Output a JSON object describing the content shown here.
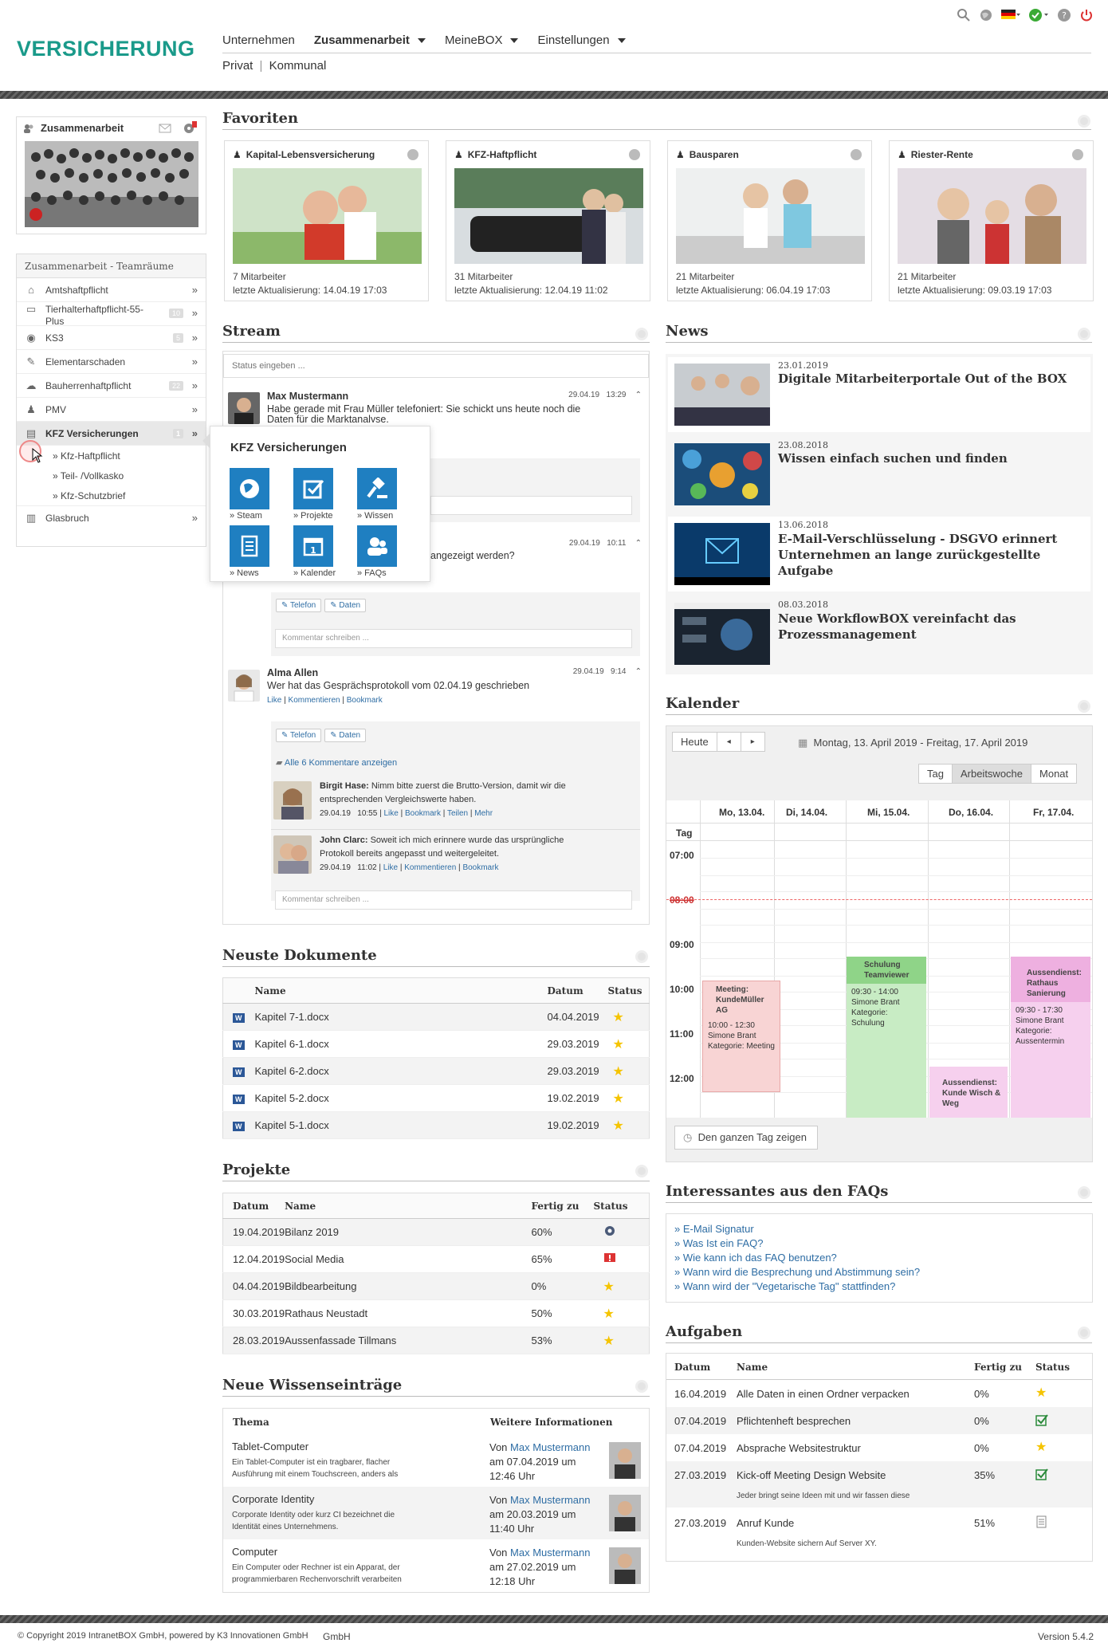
{
  "header": {
    "logo": "VERSICHERUNG",
    "nav": [
      {
        "label": "Unternehmen"
      },
      {
        "label": "Zusammenarbeit"
      },
      {
        "label": "MeineBOX"
      },
      {
        "label": "Einstellungen"
      }
    ],
    "subnav": [
      "Privat",
      "Kommunal"
    ]
  },
  "sidebar": {
    "group_title": "Zusammenarbeit",
    "teamraeume_title": "Zusammenarbeit - Teamräume",
    "items": [
      {
        "label": "Amtshaftpflicht",
        "count": ""
      },
      {
        "label": "Tierhalterhaftpflicht-55-",
        "label2": "Plus",
        "count": "10"
      },
      {
        "label": "KS3",
        "count": "5"
      },
      {
        "label": "Elementarschaden",
        "count": ""
      },
      {
        "label": "Bauherrenhaftpflicht",
        "count": "22"
      },
      {
        "label": "PMV",
        "count": ""
      },
      {
        "label": "KFZ Versicherungen",
        "count": "1"
      }
    ],
    "subitems": [
      "» Kfz-Haftpflicht",
      "» Teil- /Vollkasko",
      "» Kfz-Schutzbrief"
    ],
    "last": {
      "label": "Glasbruch"
    },
    "arrow": "»"
  },
  "popup": {
    "title": "KFZ Versicherungen",
    "tiles": [
      "» Steam",
      "» Projekte",
      "» Wissen",
      "» News",
      "» Kalender",
      "» FAQs"
    ]
  },
  "favoriten": {
    "title": "Favoriten",
    "cards": [
      {
        "title": "Kapital-Lebensversicherung",
        "staff": "7 Mitarbeiter",
        "updated": "letzte Aktualisierung: 14.04.19 17:03"
      },
      {
        "title": "KFZ-Haftpflicht",
        "staff": "31 Mitarbeiter",
        "updated": "letzte Aktualisierung: 12.04.19 11:02"
      },
      {
        "title": "Bausparen",
        "staff": "21 Mitarbeiter",
        "updated": "letzte Aktualisierung: 06.04.19 17:03"
      },
      {
        "title": "Riester-Rente",
        "staff": "21 Mitarbeiter",
        "updated": "letzte Aktualisierung: 09.03.19 17:03"
      }
    ]
  },
  "stream": {
    "title": "Stream",
    "placeholder": "Status eingeben ...",
    "post1": {
      "author": "Max Mustermann",
      "date": "29.04.19",
      "time": "13:29",
      "text": "Habe gerade mit Frau Müller telefoniert: Sie schickt uns heute noch die",
      "text2": "Daten für die Marktanalyse."
    },
    "post2": {
      "date": "29.04.19",
      "time": "10:11",
      "text": "angezeigt werden?"
    },
    "tags": [
      "Telefon",
      "Daten"
    ],
    "comment_placeholder": "Kommentar schreiben ...",
    "post3": {
      "author": "Alma Allen",
      "date": "29.04.19",
      "time": "9:14",
      "text": "Wer hat das Gesprächsprotokoll vom 02.04.19 geschrieben",
      "actions": [
        "Like",
        "Kommentieren",
        "Bookmark"
      ]
    },
    "all_comments": "Alle 6 Kommentare anzeigen",
    "c1": {
      "author": "Birgit Hase:",
      "text": "Nimm bitte zuerst die Brutto-Version, damit wir die",
      "text2": "entsprechenden Vergleichswerte haben.",
      "date": "29.04.19",
      "time": "10:55",
      "actions": [
        "Like",
        "Bookmark",
        "Teilen",
        "Mehr"
      ]
    },
    "c2": {
      "author": "John Clarc:",
      "text": "Soweit ich mich erinnere wurde das ursprüngliche",
      "text2": "Protokoll bereits angepasst und weitergeleitet.",
      "date": "29.04.19",
      "time": "11:02",
      "actions": [
        "Like",
        "Kommentieren",
        "Bookmark"
      ]
    }
  },
  "news": {
    "title": "News",
    "items": [
      {
        "date": "23.01.2019",
        "title": "Digitale Mitarbeiterportale Out of the BOX",
        "title2": ""
      },
      {
        "date": "23.08.2018",
        "title": "Wissen einfach suchen und finden",
        "title2": ""
      },
      {
        "date": "13.06.2018",
        "title": "E-Mail-Verschlüsselung - DSGVO erinnert",
        "title2": "Unternehmen an lange zurückgestellte Aufgabe"
      },
      {
        "date": "08.03.2018",
        "title": "Neue WorkflowBOX vereinfacht das",
        "title2": "Prozessmanagement"
      }
    ]
  },
  "kalender": {
    "title": "Kalender",
    "today": "Heute",
    "prev": "◂",
    "next": "▸",
    "range": "Montag, 13. April 2019 - Freitag, 17. April 2019",
    "views": [
      "Tag",
      "Arbeitswoche",
      "Monat"
    ],
    "days": [
      "Mo, 13.04.",
      "Di, 14.04.",
      "Mi, 15.04.",
      "Do, 16.04.",
      "Fr, 17.04."
    ],
    "tag_label": "Tag",
    "hours": [
      "07:00",
      "08:00",
      "09:00",
      "10:00",
      "11:00",
      "12:00"
    ],
    "events": [
      {
        "title": "Meeting: KundeMüller AG",
        "time": "10:00 - 12:30",
        "person": "Simone Brant",
        "category": "Kategorie: Meeting"
      },
      {
        "title": "Schulung Teamviewer",
        "time": "09:30 - 14:00",
        "person": "Simone Brant",
        "category": "Kategorie: Schulung"
      },
      {
        "title": "Aussendienst: Kunde Wisch & Weg",
        "time": "",
        "person": "",
        "category": ""
      },
      {
        "title": "Aussendienst: Rathaus Sanierung",
        "time": "09:30 - 17:30",
        "person": "Simone Brant",
        "category": "Kategorie: Aussentermin"
      }
    ],
    "allday": "Den ganzen Tag zeigen",
    "colors": {
      "meeting": "#f8d4d4",
      "schulung": "#c8ecc4",
      "aussendienst": "#f6d0ee"
    }
  },
  "dokumente": {
    "title": "Neuste Dokumente",
    "headers": [
      "Name",
      "Datum",
      "Status"
    ],
    "rows": [
      {
        "name": "Kapitel 7-1.docx",
        "date": "04.04.2019"
      },
      {
        "name": "Kapitel 6-1.docx",
        "date": "29.03.2019"
      },
      {
        "name": "Kapitel 6-2.docx",
        "date": "29.03.2019"
      },
      {
        "name": "Kapitel 5-2.docx",
        "date": "19.02.2019"
      },
      {
        "name": "Kapitel 5-1.docx",
        "date": "19.02.2019"
      }
    ],
    "doc_icon": "W"
  },
  "projekte": {
    "title": "Projekte",
    "headers": [
      "Datum",
      "Name",
      "Fertig zu",
      "Status"
    ],
    "rows": [
      {
        "date": "19.04.2019",
        "name": "Bilanz 2019",
        "pct": "60%",
        "status": "gear-icon"
      },
      {
        "date": "12.04.2019",
        "name": "Social Media",
        "pct": "65%",
        "status": "alert-icon"
      },
      {
        "date": "04.04.2019",
        "name": "Bildbearbeitung",
        "pct": "0%",
        "status": "star-icon"
      },
      {
        "date": "30.03.2019",
        "name": "Rathaus Neustadt",
        "pct": "50%",
        "status": "star-icon"
      },
      {
        "date": "28.03.2019",
        "name": "Aussenfassade Tillmans",
        "pct": "53%",
        "status": "star-icon"
      }
    ]
  },
  "wissen": {
    "title": "Neue Wissenseinträge",
    "headers": [
      "Thema",
      "Weitere Informationen"
    ],
    "rows": [
      {
        "topic": "Tablet-Computer",
        "desc": "Ein Tablet-Computer ist ein tragbarer, flacher",
        "desc2": "Ausführung mit einem Touchscreen, anders als",
        "von": "Von",
        "author": "Max Mustermann",
        "date": "am 07.04.2019 um",
        "time": "12:46 Uhr"
      },
      {
        "topic": "Corporate Identity",
        "desc": "Corporate Identity oder kurz CI bezeichnet die",
        "desc2": "Identität eines Unternehmens.",
        "von": "Von",
        "author": "Max Mustermann",
        "date": "am 20.03.2019 um",
        "time": "11:40 Uhr"
      },
      {
        "topic": "Computer",
        "desc": "Ein Computer oder Rechner ist ein Apparat, der",
        "desc2": "programmierbaren Rechenvorschrift verarbeiten",
        "von": "Von",
        "author": "Max Mustermann",
        "date": "am 27.02.2019 um",
        "time": "12:18 Uhr"
      }
    ]
  },
  "faqs": {
    "title": "Interessantes aus den FAQs",
    "items": [
      "» E-Mail Signatur",
      "» Was Ist ein FAQ?",
      "» Wie kann ich das FAQ benutzen?",
      "» Wann wird die Besprechung und Abstimmung sein?",
      "» Wann wird der \"Vegetarische Tag\" stattfinden?"
    ]
  },
  "aufgaben": {
    "title": "Aufgaben",
    "headers": [
      "Datum",
      "Name",
      "Fertig zu",
      "Status"
    ],
    "rows": [
      {
        "date": "16.04.2019",
        "name": "Alle Daten in einen Ordner verpacken",
        "pct": "0%",
        "status": "star-icon",
        "note": ""
      },
      {
        "date": "07.04.2019",
        "name": "Pflichtenheft besprechen",
        "pct": "0%",
        "status": "check-icon",
        "note": ""
      },
      {
        "date": "07.04.2019",
        "name": "Absprache Websitestruktur",
        "pct": "0%",
        "status": "star-icon",
        "note": ""
      },
      {
        "date": "27.03.2019",
        "name": "Kick-off Meeting Design Website",
        "pct": "35%",
        "status": "check-icon",
        "note": "Jeder bringt seine Ideen mit und wir fassen diese"
      },
      {
        "date": "27.03.2019",
        "name": "Anruf Kunde",
        "pct": "51%",
        "status": "doc-icon",
        "note": "Kunden-Website sichern Auf Server XY."
      }
    ]
  },
  "footer": {
    "copyright": "© Copyright 2019 IntranetBOX GmbH, powered by K3 Innovationen GmbH",
    "suffix": "GmbH",
    "version": "Version 5.4.2"
  }
}
